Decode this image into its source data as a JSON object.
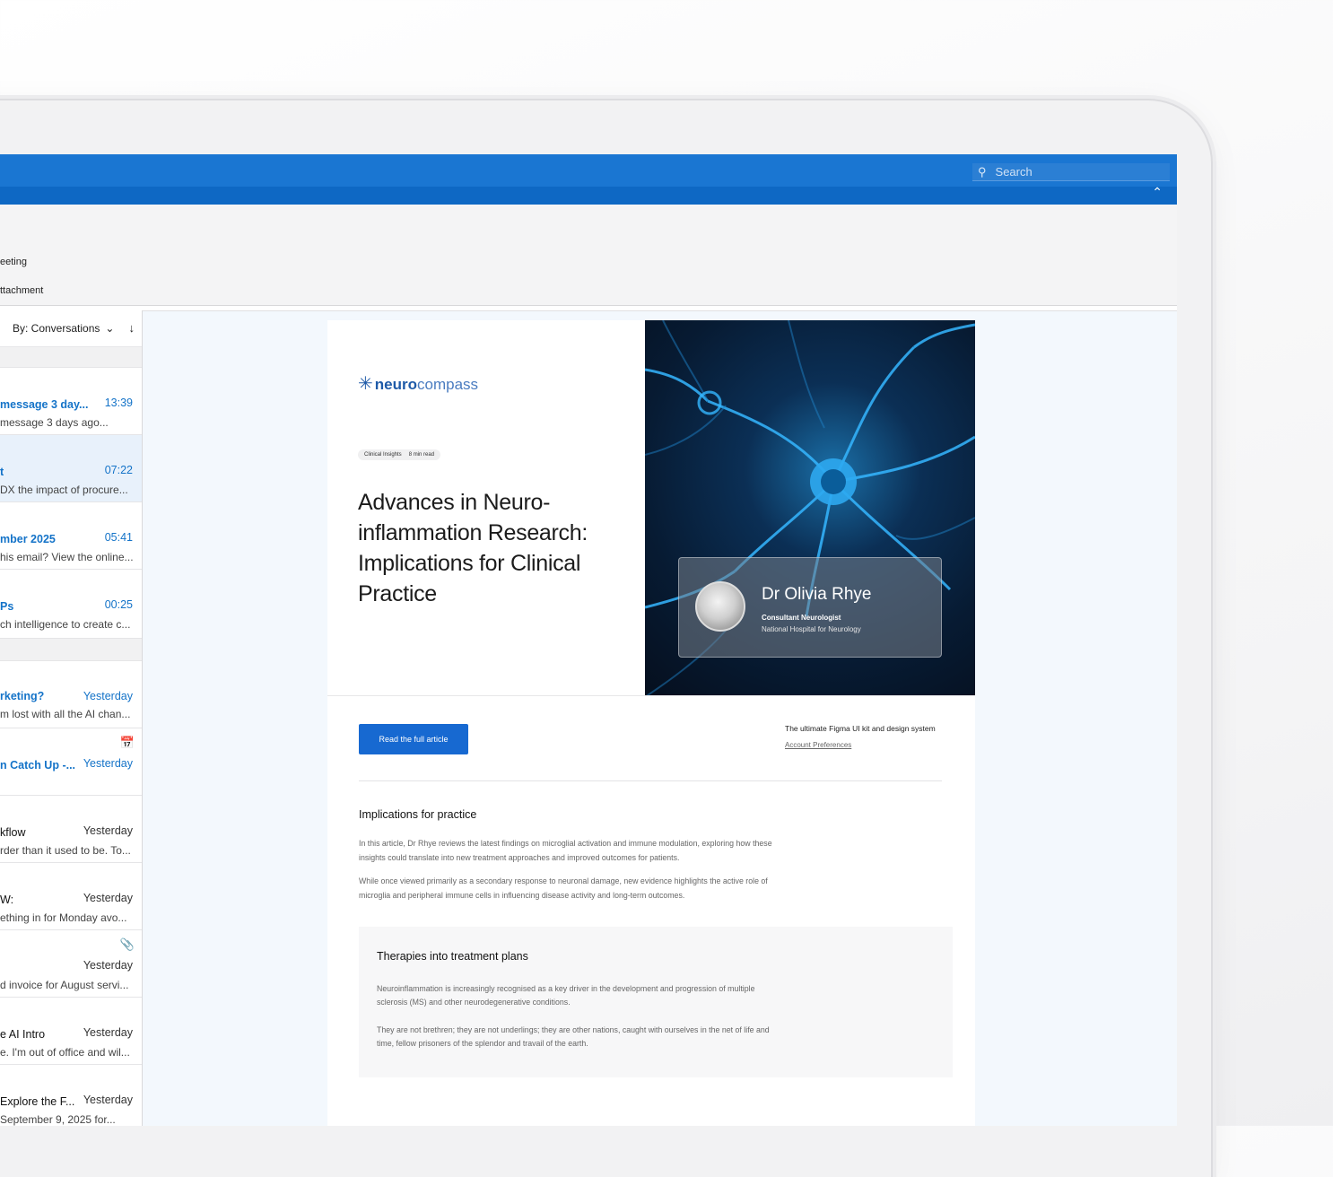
{
  "search": {
    "placeholder": "Search"
  },
  "ribbon": {
    "item_1": "eeting",
    "item_2": "ttachment"
  },
  "list": {
    "sort_label": "By: Conversations",
    "messages": [
      {
        "subject": "message 3 day...",
        "time": "13:39",
        "preview": "message 3 days ago...",
        "unread": true,
        "selected": false
      },
      {
        "subject": "t",
        "time": "07:22",
        "preview": "DX the impact of procure...",
        "unread": true,
        "selected": true
      },
      {
        "subject": "mber 2025",
        "time": "05:41",
        "preview": "his email? View the online...",
        "unread": true,
        "selected": false
      },
      {
        "subject": "Ps",
        "time": "00:25",
        "preview": "ch intelligence to create c...",
        "unread": true,
        "selected": false
      },
      {
        "subject": "rketing?",
        "time": "Yesterday",
        "preview": "m lost with all the AI chan...",
        "unread": true,
        "selected": false
      },
      {
        "subject": "n Catch Up -...",
        "time": "Yesterday",
        "preview": "",
        "unread": true,
        "selected": false
      },
      {
        "subject": "kflow",
        "time": "Yesterday",
        "preview": "rder than it used to be. To...",
        "unread": false,
        "selected": false
      },
      {
        "subject": "W:",
        "time": "Yesterday",
        "preview": "ething in for Monday avo...",
        "unread": false,
        "selected": false
      },
      {
        "subject": "",
        "time": "Yesterday",
        "preview": "d invoice for August servi...",
        "unread": false,
        "selected": false
      },
      {
        "subject": "e AI Intro",
        "time": "Yesterday",
        "preview": "e. I'm out of office and wil...",
        "unread": false,
        "selected": false
      },
      {
        "subject": "Explore the F...",
        "time": "Yesterday",
        "preview": "September 9, 2025 for...",
        "unread": false,
        "selected": false
      }
    ]
  },
  "email": {
    "logo_bold": "neuro",
    "logo_light": "compass",
    "pill_1": "Clinical Insights",
    "pill_2": "8 min read",
    "title": "Advances in Neuro-inflammation Research: Implications for Clinical Practice",
    "author_name": "Dr Olivia Rhye",
    "author_role": "Consultant Neurologist",
    "author_org": "National Hospital for Neurology",
    "cta": "Read the full article",
    "tagline": "The ultimate Figma UI kit and design system",
    "account_link": "Account Preferences",
    "section1_title": "Implications for practice",
    "section1_p1": "In this article, Dr Rhye reviews the latest findings on microglial activation and immune modulation, exploring how these insights could translate into new treatment approaches and improved outcomes for patients.",
    "section1_p2": "While once viewed primarily as a secondary response to neuronal damage, new evidence highlights the active role of microglia and peripheral immune cells in influencing disease activity and long-term outcomes.",
    "panel_title": "Therapies into treatment plans",
    "panel_p1": "Neuroinflammation is increasingly recognised as a key driver in the development and progression of multiple sclerosis (MS) and other neurodegenerative conditions.",
    "panel_p2": "They are not brethren; they are not underlings; they are other nations, caught with ourselves in the net of life and time, fellow prisoners of the splendor and travail of the earth."
  },
  "colors": {
    "accent": "#1a76d2",
    "cta": "#1769d1",
    "link": "#1473c8"
  }
}
